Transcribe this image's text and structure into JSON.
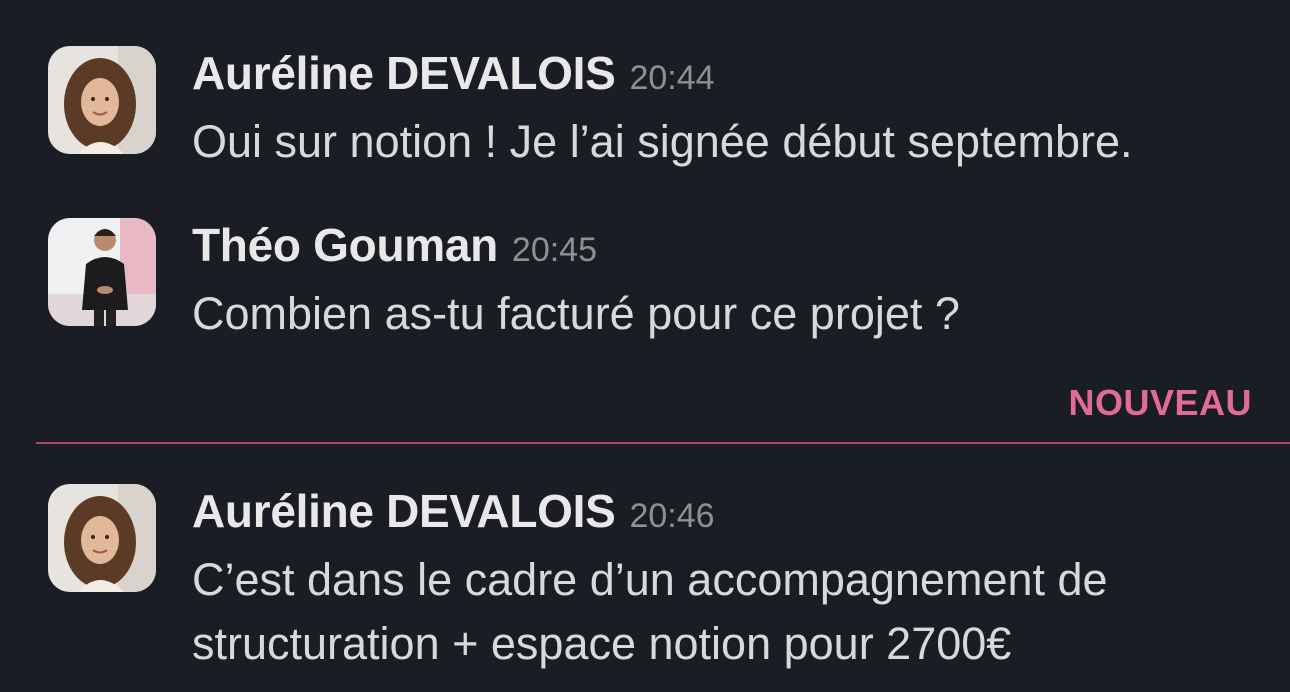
{
  "messages": [
    {
      "author": "Auréline DEVALOIS",
      "time": "20:44",
      "text": "Oui sur notion ! Je l’ai signée début septembre.",
      "avatar": "woman-curly-hair-avatar"
    },
    {
      "author": "Théo Gouman",
      "time": "20:45",
      "text": "Combien as-tu facturé pour ce projet ?",
      "avatar": "man-black-sweater-avatar"
    },
    {
      "author": "Auréline DEVALOIS",
      "time": "20:46",
      "text": "C’est dans le cadre d’un accompagnement de\nstructuration + espace notion pour 2700€",
      "avatar": "woman-curly-hair-avatar"
    }
  ],
  "divider": {
    "label": "NOUVEAU",
    "color": "#e06c96"
  },
  "theme": {
    "background": "#1a1d24",
    "text": "#d8d9da",
    "timestamp": "#8f9096"
  }
}
